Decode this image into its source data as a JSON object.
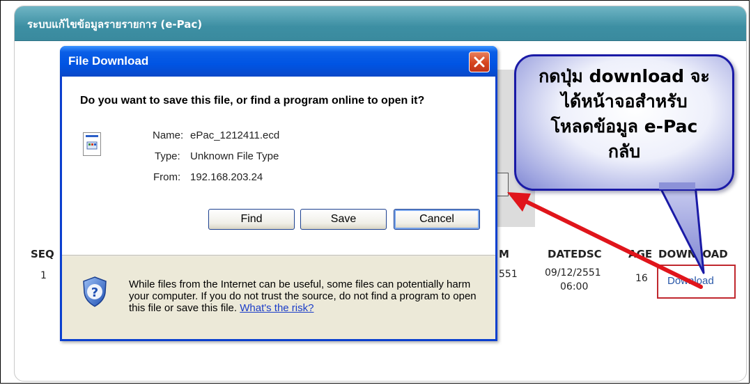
{
  "page": {
    "header_title": "ระบบแก้ไขข้อมูลรายรายการ (e-Pac)"
  },
  "table": {
    "columns": {
      "seq": "SEQ",
      "m": "M",
      "datedsc": "DATEDSC",
      "age": "AGE",
      "download": "DOWNLOAD"
    },
    "rows": [
      {
        "seq": "1",
        "m": "551",
        "datedsc_line1": "09/12/2551",
        "datedsc_line2": "06:00",
        "age": "16",
        "download": "Download"
      }
    ]
  },
  "callout": {
    "line1": "กดปุ่ม download จะ",
    "line2": "ได้หน้าจอสำหรับ",
    "line3": "โหลดข้อมูล e-Pac",
    "line4": "กลับ"
  },
  "dialog": {
    "title": "File Download",
    "question": "Do you want to save this file, or find a program online to open it?",
    "name_label": "Name:",
    "name_value": "ePac_1212411.ecd",
    "type_label": "Type:",
    "type_value": "Unknown File Type",
    "from_label": "From:",
    "from_value": "192.168.203.24",
    "find_button": "Find",
    "save_button": "Save",
    "cancel_button": "Cancel",
    "warning_text": "While files from the Internet can be useful, some files can potentially harm your computer. If you do not trust the source, do not find a program to open this file or save this file.",
    "warning_link": "What's the risk?"
  },
  "colors": {
    "header": "#3d8fa3",
    "dialog_title": "#0054e3",
    "highlight_box": "#c0272d",
    "arrow": "#e0151b",
    "callout_border": "#1a1aa6"
  }
}
